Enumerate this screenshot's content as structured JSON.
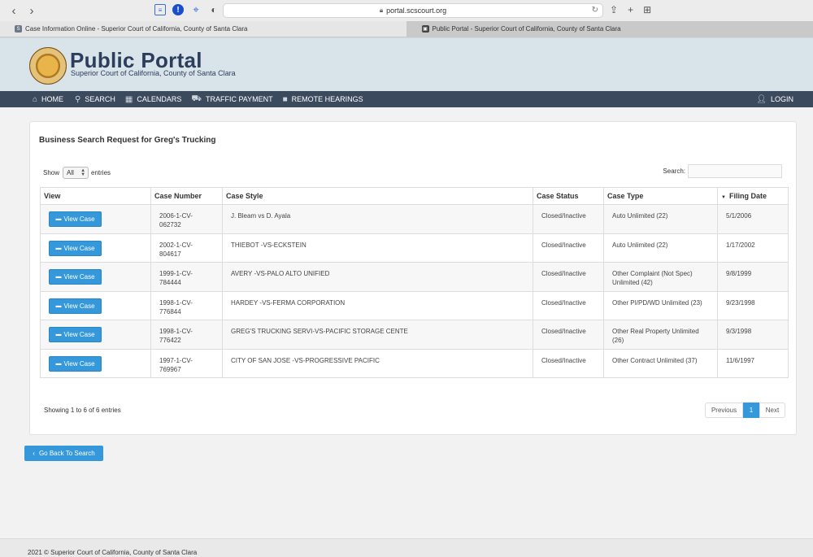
{
  "browser": {
    "url": "portal.scscourt.org",
    "tabs": [
      {
        "title": "Case Information Online - Superior Court of California, County of Santa Clara",
        "favicon": "S"
      },
      {
        "title": "Public Portal - Superior Court of California, County of Santa Clara",
        "favicon": "▣"
      }
    ]
  },
  "header": {
    "title": "Public Portal",
    "subtitle": "Superior Court of California, County of Santa Clara"
  },
  "nav": {
    "home": "HOME",
    "search": "SEARCH",
    "calendars": "CALENDARS",
    "traffic": "TRAFFIC PAYMENT",
    "remote": "REMOTE HEARINGS",
    "login": "LOGIN"
  },
  "panel": {
    "title": "Business Search Request for Greg's Trucking",
    "show_label": "Show",
    "length_value": "All",
    "entries_label": "entries",
    "search_label": "Search:",
    "search_value": ""
  },
  "table": {
    "headers": {
      "view": "View",
      "case_number": "Case Number",
      "case_style": "Case Style",
      "case_status": "Case Status",
      "case_type": "Case Type",
      "filing_date": "Filing Date"
    },
    "view_button_label": "View Case",
    "rows": [
      {
        "case_number": "2006-1-CV-062732",
        "case_style": "J. Bleam vs D. Ayala",
        "case_status": "Closed/Inactive",
        "case_type": "Auto Unlimited (22)",
        "filing_date": "5/1/2006"
      },
      {
        "case_number": "2002-1-CV-804617",
        "case_style": "THIEBOT -VS-ECKSTEIN",
        "case_status": "Closed/Inactive",
        "case_type": "Auto Unlimited (22)",
        "filing_date": "1/17/2002"
      },
      {
        "case_number": "1999-1-CV-784444",
        "case_style": "AVERY -VS-PALO ALTO UNIFIED",
        "case_status": "Closed/Inactive",
        "case_type": "Other Complaint (Not Spec) Unlimited (42)",
        "filing_date": "9/8/1999"
      },
      {
        "case_number": "1998-1-CV-776844",
        "case_style": "HARDEY -VS-FERMA CORPORATION",
        "case_status": "Closed/Inactive",
        "case_type": "Other PI/PD/WD Unlimited (23)",
        "filing_date": "9/23/1998"
      },
      {
        "case_number": "1998-1-CV-776422",
        "case_style": "GREG'S TRUCKING SERVI-VS-PACIFIC STORAGE CENTE",
        "case_status": "Closed/Inactive",
        "case_type": "Other Real Property Unlimited (26)",
        "filing_date": "9/3/1998"
      },
      {
        "case_number": "1997-1-CV-769967",
        "case_style": "CITY OF SAN JOSE -VS-PROGRESSIVE PACIFIC",
        "case_status": "Closed/Inactive",
        "case_type": "Other Contract Unlimited (37)",
        "filing_date": "11/6/1997"
      }
    ]
  },
  "pagination": {
    "info": "Showing 1 to 6 of 6 entries",
    "previous": "Previous",
    "current": "1",
    "next": "Next"
  },
  "back_button": "Go Back To Search",
  "footer": "2021 © Superior Court of California, County of Santa Clara",
  "colors": {
    "accent": "#3498db",
    "nav_bg": "#3c4a5e",
    "header_bg": "#d9e3ea"
  }
}
